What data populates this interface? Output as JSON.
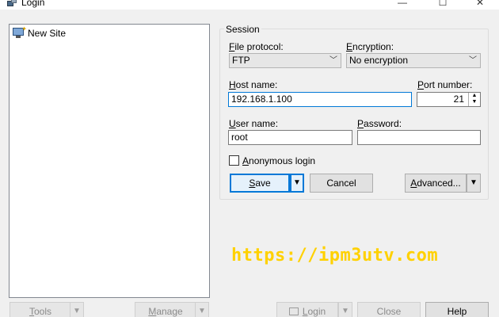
{
  "window": {
    "title": "Login",
    "minimize": "—",
    "maximize": "☐",
    "close": "✕"
  },
  "sites": [
    {
      "label": "New Site",
      "icon": "new-site-monitor-icon"
    }
  ],
  "session": {
    "legend": "Session",
    "file_protocol": {
      "label_accel": "F",
      "label_rest": "ile protocol:",
      "value": "FTP"
    },
    "encryption": {
      "label_accel": "E",
      "label_rest": "ncryption:",
      "value": "No encryption"
    },
    "host_name": {
      "label_accel": "H",
      "label_rest": "ost name:",
      "value": "192.168.1.100"
    },
    "port_number": {
      "label_accel": "P",
      "label_rest": "ort number:",
      "value": "21"
    },
    "user_name": {
      "label_accel": "U",
      "label_rest": "ser name:",
      "value": "root"
    },
    "password": {
      "label_accel": "P",
      "label_rest": "assword:",
      "value": ""
    },
    "anonymous": {
      "label_accel": "A",
      "label_rest": "nonymous login",
      "checked": false
    },
    "save_label_accel": "S",
    "save_label_rest": "ave",
    "cancel_label": "Cancel",
    "advanced_label_accel": "A",
    "advanced_label_rest": "dvanced..."
  },
  "bottom": {
    "tools_label_accel": "T",
    "tools_label_rest": "ools",
    "manage_label_accel": "M",
    "manage_label_rest": "anage",
    "login_label_accel": "L",
    "login_label_rest": "ogin",
    "close_label": "Close",
    "help_label": "Help"
  },
  "watermark": "https://ipm3utv.com",
  "colors": {
    "accent": "#0078d7",
    "watermark": "#ffd100"
  }
}
